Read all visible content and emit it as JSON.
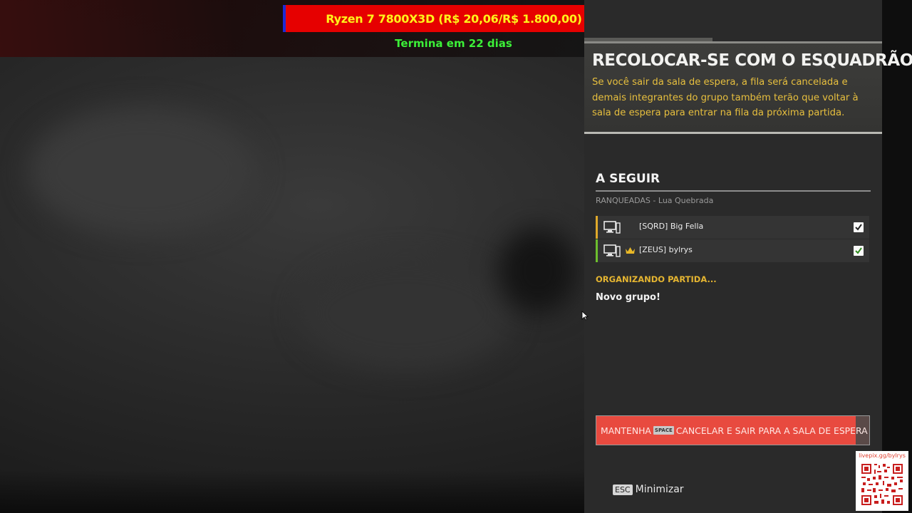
{
  "overlay": {
    "goal_title": "Ryzen 7 7800X3D (R$ 20,06/R$ 1.800,00)",
    "goal_subtitle": "Termina em 22 dias",
    "qr_url": "livepix.gg/bylrys"
  },
  "warning": {
    "title": "RECOLOCAR-SE COM O ESQUADRÃO",
    "text": "Se você sair da sala de espera, a fila será cancelada e demais integrantes do grupo também terão que voltar à sala de espera para entrar na fila da próxima partida."
  },
  "next": {
    "title": "A SEGUIR",
    "mode": "RANQUEADAS - Lua Quebrada",
    "members": [
      {
        "name": "[SQRD] Big Fella",
        "leader": false,
        "ready": true,
        "accent": "#e0a92a"
      },
      {
        "name": "[ZEUS] bylrys",
        "leader": true,
        "ready": true,
        "accent": "#6dbf2e"
      }
    ],
    "status": "ORGANIZANDO PARTIDA...",
    "group_message": "Novo grupo!"
  },
  "hold_button": {
    "prefix": "MANTENHA",
    "key": "SPACE",
    "suffix": "CANCELAR E SAIR PARA A SALA DE ESPERA",
    "color": "#e84a3f",
    "progress": 0.95
  },
  "footer": {
    "esc_key": "ESC",
    "esc_label": "Minimizar"
  }
}
